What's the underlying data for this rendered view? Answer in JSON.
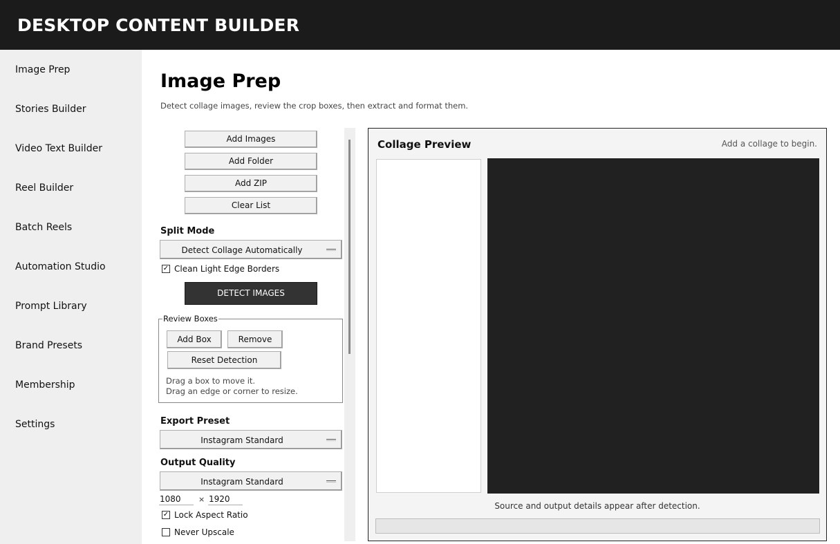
{
  "app": {
    "title": "DESKTOP CONTENT BUILDER"
  },
  "sidebar": {
    "items": [
      {
        "label": "Image Prep"
      },
      {
        "label": "Stories Builder"
      },
      {
        "label": "Video Text Builder"
      },
      {
        "label": "Reel Builder"
      },
      {
        "label": "Batch Reels"
      },
      {
        "label": "Automation Studio"
      },
      {
        "label": "Prompt Library"
      },
      {
        "label": "Brand Presets"
      },
      {
        "label": "Membership"
      },
      {
        "label": "Settings"
      }
    ]
  },
  "page": {
    "title": "Image Prep",
    "subtitle": "Detect collage images, review the crop boxes, then extract and format them."
  },
  "controls": {
    "add_images": "Add Images",
    "add_folder": "Add Folder",
    "add_zip": "Add ZIP",
    "clear_list": "Clear List",
    "split_mode_label": "Split Mode",
    "split_mode_value": "Detect Collage Automatically",
    "clean_borders_label": "Clean Light Edge Borders",
    "clean_borders_checked": true,
    "detect_button": "DETECT IMAGES",
    "review": {
      "legend": "Review Boxes",
      "add_box": "Add Box",
      "remove": "Remove",
      "reset": "Reset Detection",
      "hint1": "Drag a box to move it.",
      "hint2": "Drag an edge or corner to resize."
    },
    "export_preset_label": "Export Preset",
    "export_preset_value": "Instagram Standard",
    "output_quality_label": "Output Quality",
    "output_quality_value": "Instagram Standard",
    "width": "1080",
    "times": "×",
    "height": "1920",
    "lock_aspect_label": "Lock Aspect Ratio",
    "lock_aspect_checked": true,
    "never_upscale_label": "Never Upscale",
    "never_upscale_checked": false
  },
  "preview": {
    "title": "Collage Preview",
    "hint": "Add a collage to begin.",
    "details": "Source and output details appear after detection."
  },
  "icons": {
    "check": "✓"
  }
}
